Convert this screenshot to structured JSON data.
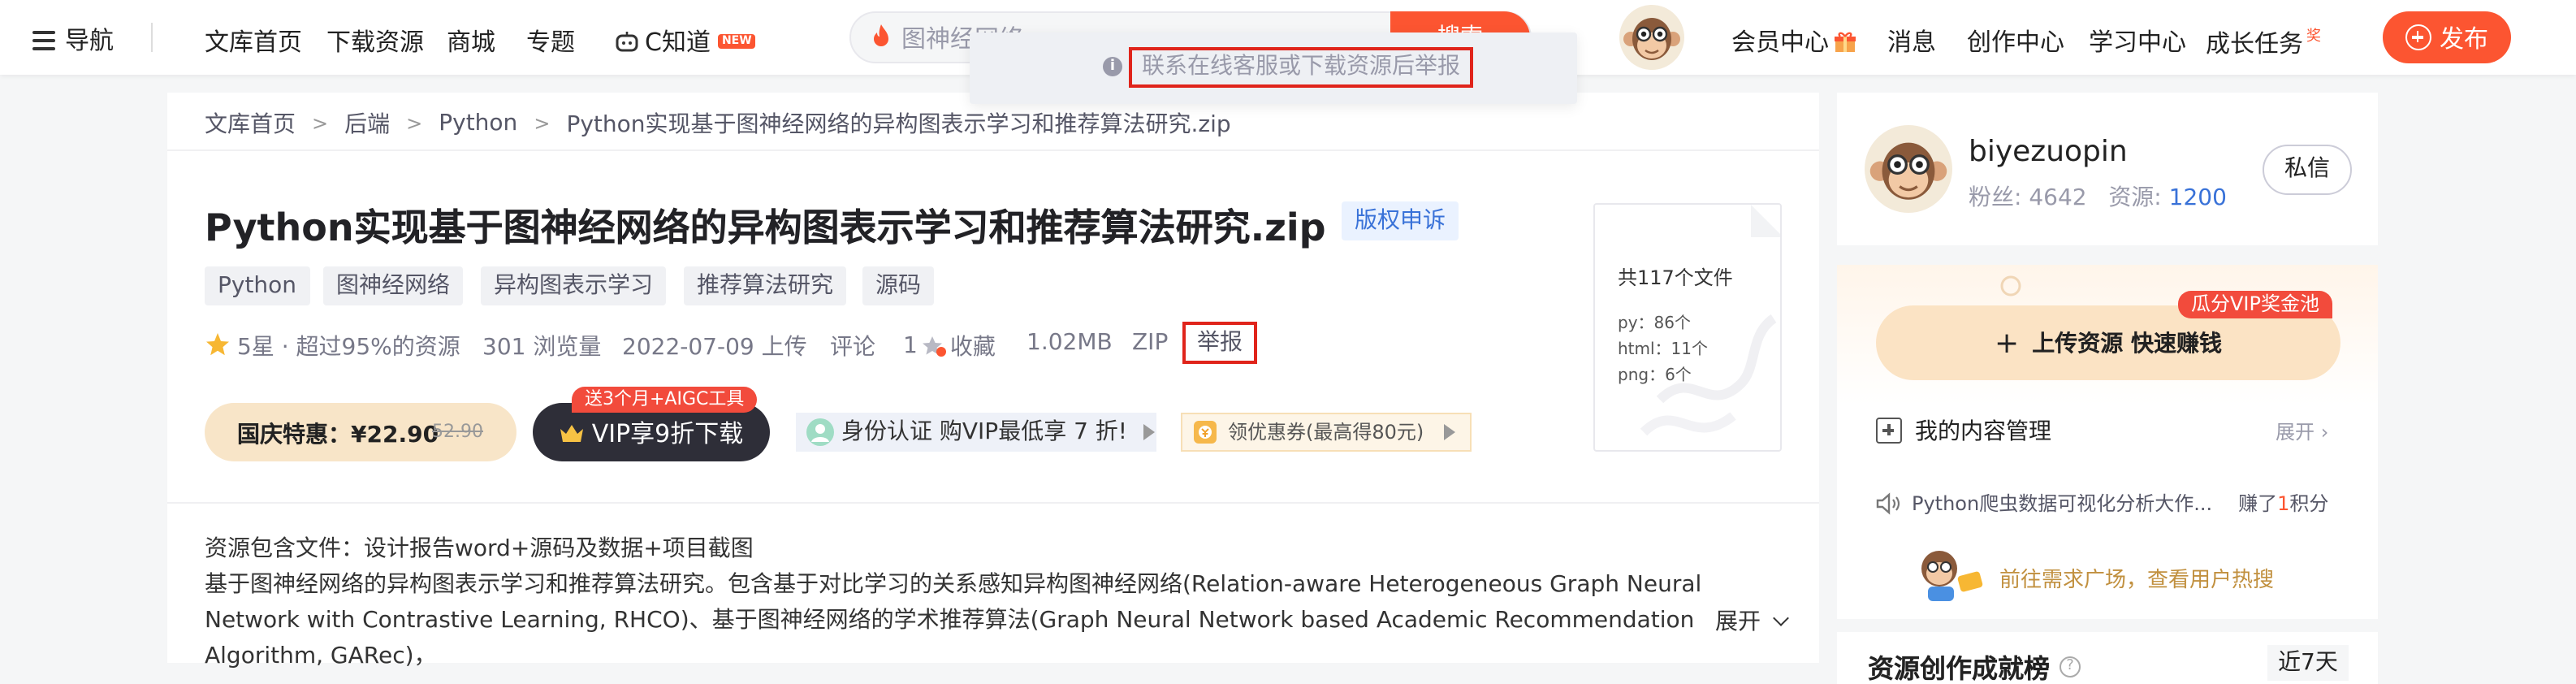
{
  "nav": {
    "menu_label": "导航",
    "links": [
      "文库首页",
      "下载资源",
      "商城",
      "专题"
    ],
    "cknow_label": "C知道",
    "cknow_badge": "NEW",
    "search_placeholder": "图神经网络",
    "search_button": "搜索",
    "right_links": [
      "会员中心",
      "消息",
      "创作中心",
      "学习中心",
      "成长任务"
    ],
    "task_badge": "奖",
    "publish_label": "发布"
  },
  "tooltip": {
    "text": "联系在线客服或下载资源后举报"
  },
  "breadcrumb": [
    "文库首页",
    "后端",
    "Python",
    "Python实现基于图神经网络的异构图表示学习和推荐算法研究.zip"
  ],
  "resource": {
    "title": "Python实现基于图神经网络的异构图表示学习和推荐算法研究.zip",
    "appeal_label": "版权申诉",
    "tags": [
      "Python",
      "图神经网络",
      "异构图表示学习",
      "推荐算法研究",
      "源码"
    ],
    "rating": "5星 · 超过95%的资源",
    "views": "301 浏览量",
    "date": "2022-07-09 上传",
    "comment_label": "评论",
    "collect_count": "1",
    "collect_label": "收藏",
    "size": "1.02MB",
    "format": "ZIP",
    "report_label": "举报"
  },
  "purchase": {
    "holiday_label": "国庆特惠：¥22.90",
    "original_price": "52.90",
    "vip_badge": "送3个月+AIGC工具",
    "vip_button": "VIP享9折下载",
    "promo_identity": "身份认证 购VIP最低享 7 折!",
    "promo_coupon": "领优惠券(最高得80元)"
  },
  "file_summary": {
    "total": "共117个文件",
    "rows": [
      "py：86个",
      "html：11个",
      "png：6个"
    ]
  },
  "description": {
    "contains": "资源包含文件：设计报告word+源码及数据+项目截图",
    "body": "基于图神经网络的异构图表示学习和推荐算法研究。包含基于对比学习的关系感知异构图神经网络(Relation-aware Heterogeneous Graph Neural Network with Contrastive Learning, RHCO)、基于图神经网络的学术推荐算法(Graph Neural Network based Academic Recommendation Algorithm, GARec)，",
    "expand_label": "展开"
  },
  "author": {
    "name": "biyezuopin",
    "fans_label": "粉丝: 4642",
    "res_label": "资源: ",
    "res_count": "1200",
    "message_label": "私信"
  },
  "sidebar": {
    "upload_badge": "瓜分VIP奖金池",
    "upload_label": "上传资源 快速赚钱",
    "content_mgmt": "我的内容管理",
    "content_expand": "展开",
    "notice_text": "Python爬虫数据可视化分析大作...",
    "notice_earn_prefix": "赚了",
    "notice_earn_num": "1",
    "notice_earn_suffix": "积分",
    "hot_link": "前往需求广场，查看用户热搜",
    "rank_title": "资源创作成就榜",
    "rank_period": "近7天"
  },
  "colors": {
    "brand": "#fc5531",
    "link_blue": "#3972d8",
    "highlight_box": "#e0241b"
  }
}
